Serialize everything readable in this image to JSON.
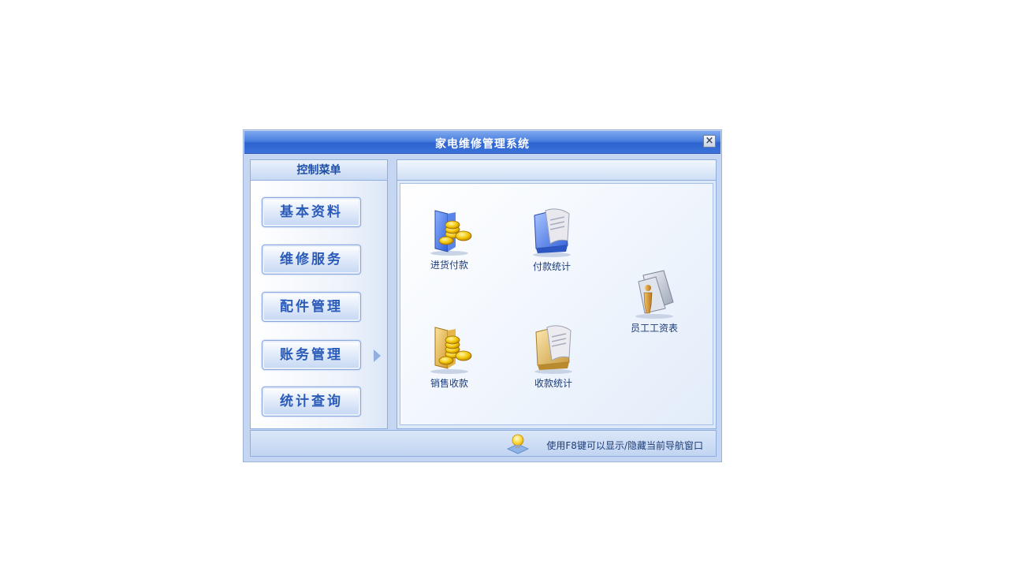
{
  "window": {
    "title": "家电维修管理系统",
    "close_label": "×"
  },
  "sidebar": {
    "header": "控制菜单",
    "items": [
      {
        "label": "基本资料"
      },
      {
        "label": "维修服务"
      },
      {
        "label": "配件管理"
      },
      {
        "label": "账务管理",
        "selected": true
      },
      {
        "label": "统计查询"
      }
    ]
  },
  "main": {
    "apps": [
      {
        "label": "进货付款",
        "icon": "blue-folder-coins-icon"
      },
      {
        "label": "付款统计",
        "icon": "blue-folder-scroll-icon"
      },
      {
        "label": "员工工资表",
        "icon": "employee-document-icon"
      },
      {
        "label": "销售收款",
        "icon": "yellow-folder-coins-icon"
      },
      {
        "label": "收款统计",
        "icon": "yellow-folder-scroll-icon"
      }
    ]
  },
  "statusbar": {
    "hint": "使用F8键可以显示/隐藏当前导航窗口",
    "icon": "lightbulb-icon"
  },
  "colors": {
    "titlebar": "#3b72da",
    "panel_border": "#8faee0",
    "button_text": "#2b5bb8"
  }
}
